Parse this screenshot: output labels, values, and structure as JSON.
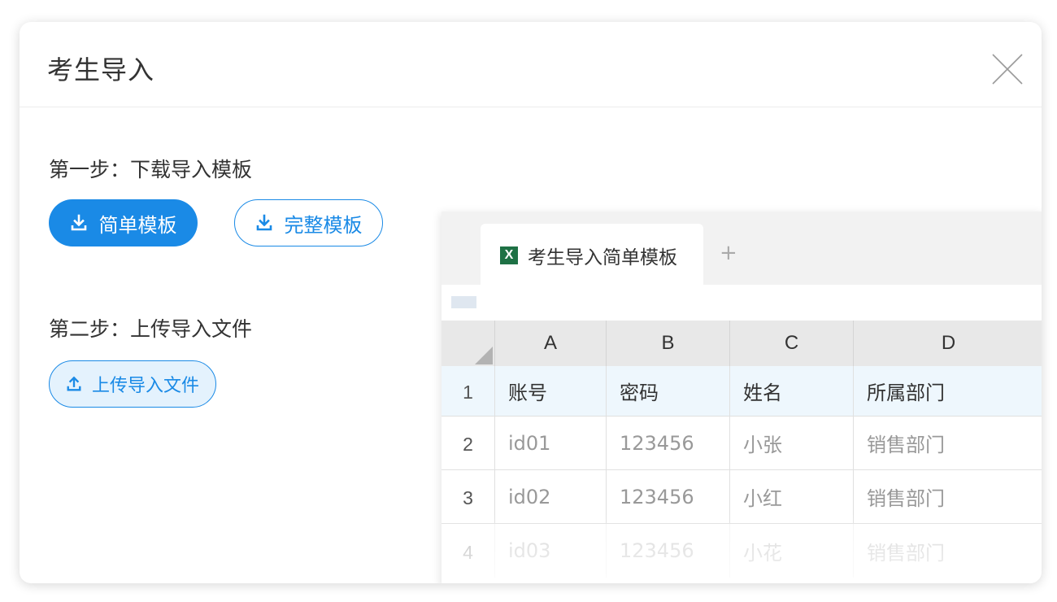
{
  "modal": {
    "title": "考生导入",
    "close_icon": "close-icon"
  },
  "step1": {
    "label": "第一步：下载导入模板",
    "buttons": [
      {
        "label": "简单模板",
        "icon": "download-icon"
      },
      {
        "label": "完整模板",
        "icon": "download-icon"
      }
    ]
  },
  "step2": {
    "label": "第二步：上传导入文件",
    "upload_button": {
      "label": "上传导入文件",
      "icon": "upload-icon"
    }
  },
  "spreadsheet": {
    "tab_label": "考生导入简单模板",
    "xls_icon_text": "X",
    "add_sheet": "+",
    "columns": [
      "A",
      "B",
      "C",
      "D"
    ],
    "rows": [
      {
        "num": "1",
        "cells": [
          "账号",
          "密码",
          "姓名",
          "所属部门"
        ]
      },
      {
        "num": "2",
        "cells": [
          "id01",
          "123456",
          "小张",
          "销售部门"
        ]
      },
      {
        "num": "3",
        "cells": [
          "id02",
          "123456",
          "小红",
          "销售部门"
        ]
      },
      {
        "num": "4",
        "cells": [
          "id03",
          "123456",
          "小花",
          "销售部门"
        ]
      }
    ]
  },
  "colors": {
    "primary": "#1a8ae6",
    "upload_bg": "#e4f2fd",
    "excel_green": "#1e7145"
  }
}
